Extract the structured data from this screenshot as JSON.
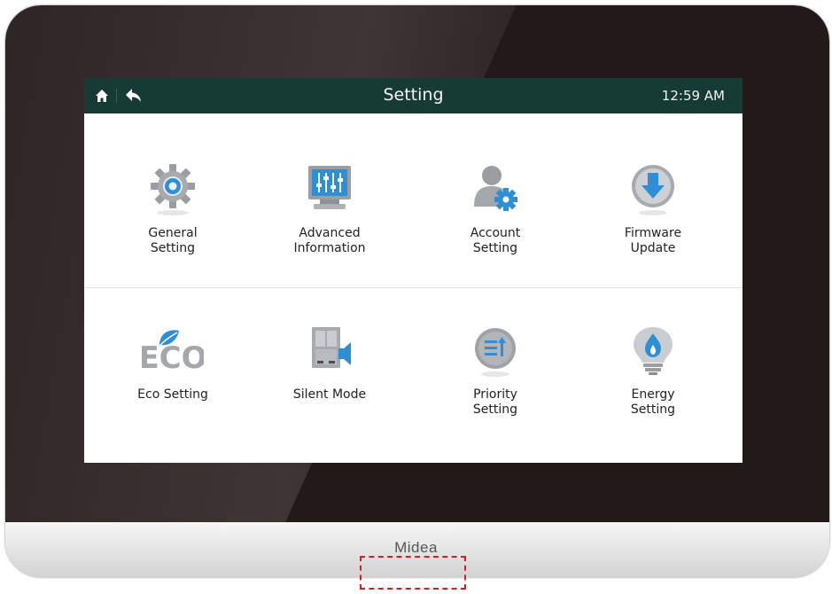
{
  "header": {
    "title": "Setting",
    "time": "12:59 AM"
  },
  "tiles": [
    {
      "label": "General\nSetting",
      "icon": "gear-icon"
    },
    {
      "label": "Advanced\nInformation",
      "icon": "monitor-sliders-icon"
    },
    {
      "label": "Account\nSetting",
      "icon": "user-gear-icon"
    },
    {
      "label": "Firmware\nUpdate",
      "icon": "download-arrow-icon"
    },
    {
      "label": "Eco Setting",
      "icon": "eco-leaf-icon"
    },
    {
      "label": "Silent Mode",
      "icon": "silent-unit-icon"
    },
    {
      "label": "Priority\nSetting",
      "icon": "priority-list-icon"
    },
    {
      "label": "Energy\nSetting",
      "icon": "energy-bulb-icon"
    }
  ],
  "brand": "Midea",
  "colors": {
    "titlebar": "#163a34",
    "accent_blue": "#2f8fd6",
    "bezel": "#221a19",
    "marker": "#d62020"
  }
}
